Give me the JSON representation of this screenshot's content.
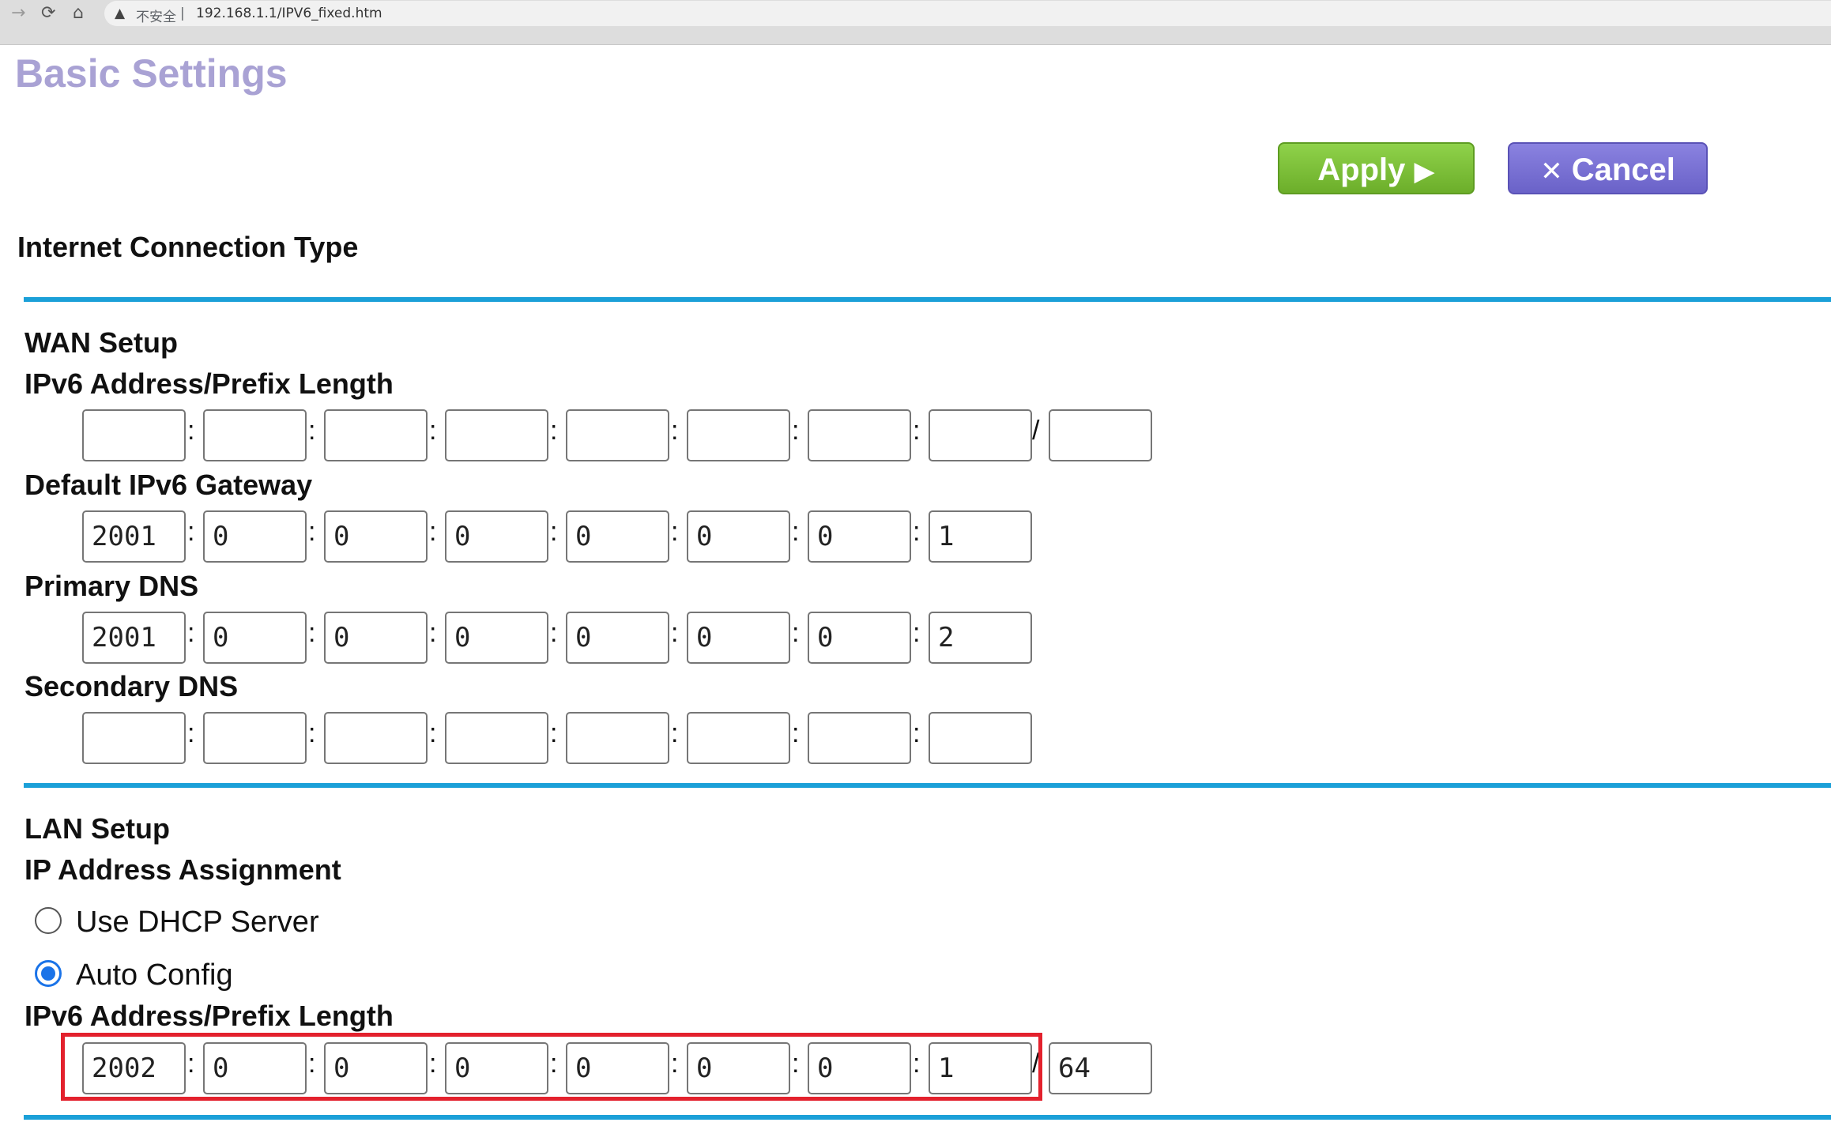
{
  "browser": {
    "security_label": "不安全",
    "url": "192.168.1.1/IPV6_fixed.htm"
  },
  "page": {
    "title": "Basic Settings"
  },
  "actions": {
    "apply_label": "Apply",
    "cancel_label": "Cancel"
  },
  "connection_type": {
    "heading": "Internet Connection Type"
  },
  "wan": {
    "heading": "WAN Setup",
    "address": {
      "label": "IPv6 Address/Prefix Length",
      "segments": [
        "",
        "",
        "",
        "",
        "",
        "",
        "",
        ""
      ],
      "prefix": ""
    },
    "gateway": {
      "label": "Default IPv6 Gateway",
      "segments": [
        "2001",
        "0",
        "0",
        "0",
        "0",
        "0",
        "0",
        "1"
      ]
    },
    "primary_dns": {
      "label": "Primary DNS",
      "segments": [
        "2001",
        "0",
        "0",
        "0",
        "0",
        "0",
        "0",
        "2"
      ]
    },
    "secondary_dns": {
      "label": "Secondary DNS",
      "segments": [
        "",
        "",
        "",
        "",
        "",
        "",
        "",
        ""
      ]
    }
  },
  "lan": {
    "heading": "LAN Setup",
    "assignment_label": "IP Address Assignment",
    "options": [
      {
        "label": "Use DHCP Server",
        "checked": false
      },
      {
        "label": "Auto Config",
        "checked": true
      }
    ],
    "address": {
      "label": "IPv6 Address/Prefix Length",
      "segments": [
        "2002",
        "0",
        "0",
        "0",
        "0",
        "0",
        "0",
        "1"
      ],
      "prefix": "64"
    }
  },
  "colors": {
    "title": "#a9a2d4",
    "apply": "#7cc13a",
    "cancel": "#7a72d8",
    "divider": "#1ba0d8",
    "highlight": "#e3212d",
    "radio_checked": "#1a73e8"
  },
  "icons": {
    "back": "arrow-right-icon",
    "reload": "reload-icon",
    "home": "home-icon",
    "security": "warning-triangle-icon",
    "apply": "play-triangle-icon",
    "cancel": "close-x-icon"
  }
}
